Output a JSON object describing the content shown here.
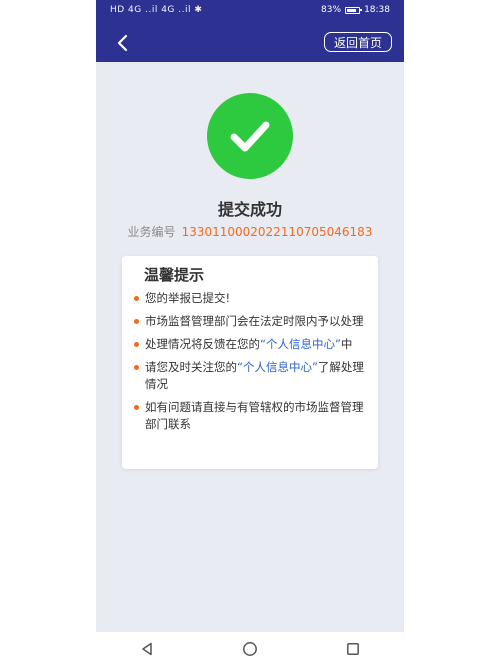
{
  "statusbar": {
    "left_text": "HD 4G ..il 4G ..il ✱",
    "battery_percent": "83%",
    "time": "18:38"
  },
  "navbar": {
    "back_icon": "chevron-left-icon",
    "home_button": "返回首页"
  },
  "result": {
    "icon": "check-icon",
    "color": "#2dc93f",
    "title": "提交成功",
    "business_no_label": "业务编号",
    "business_no": "13301100020221107050461 83"
  },
  "tips": {
    "title": "温馨提示",
    "bullet_color": "#f26a1b",
    "link_color": "#2b63c9",
    "items": [
      {
        "text": "您的举报已提交!"
      },
      {
        "text": "市场监督管理部门会在法定时限内予以处理"
      },
      {
        "before": "处理情况将反馈在您的",
        "link": "“个人信息中心”",
        "after": "中"
      },
      {
        "before": "请您及时关注您的",
        "link": "“个人信息中心”",
        "after": "了解处理情况"
      },
      {
        "text": "如有问题请直接与有管辖权的市场监督管理部门联系"
      }
    ]
  },
  "system_nav": {
    "back": "triangle-back-icon",
    "home": "circle-home-icon",
    "recents": "square-recents-icon"
  }
}
